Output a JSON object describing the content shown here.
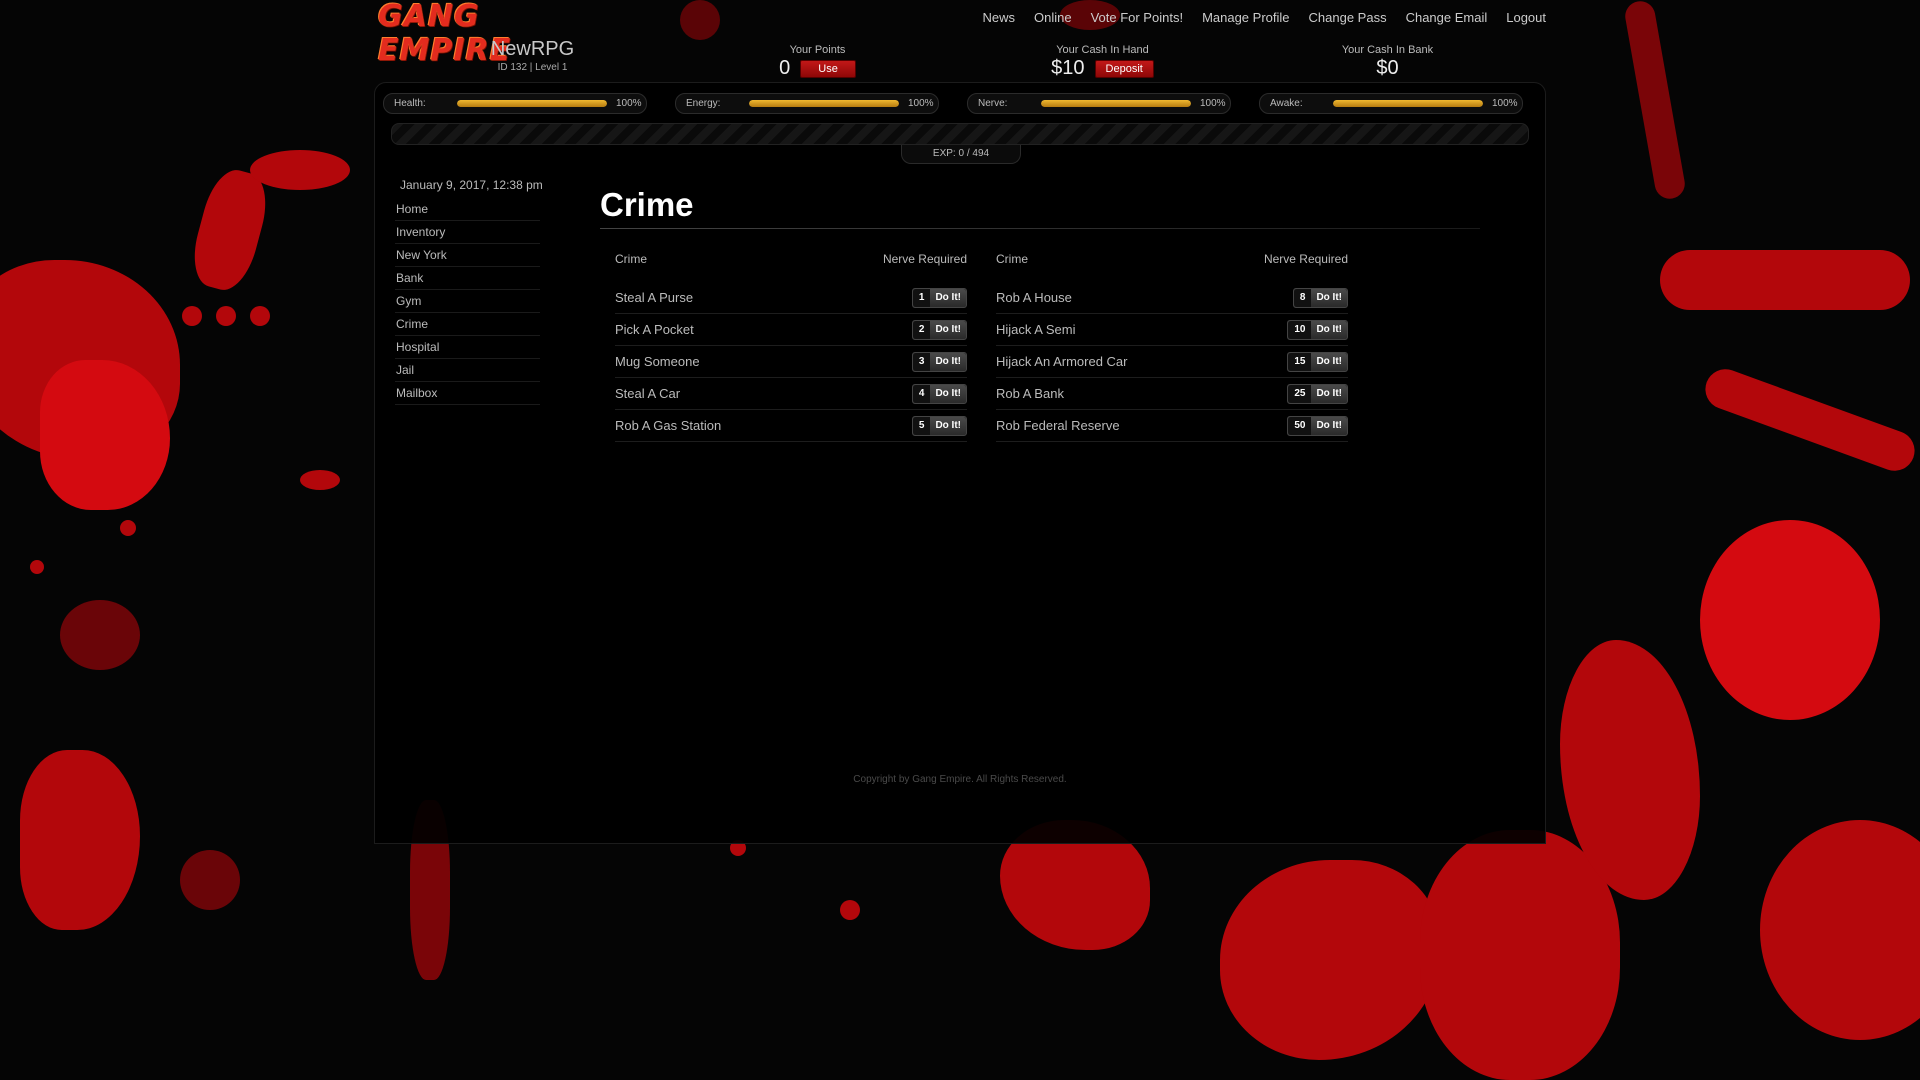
{
  "header": {
    "logo_text": "GANG EMPIRE",
    "nav": [
      "News",
      "Online",
      "Vote For Points!",
      "Manage Profile",
      "Change Pass",
      "Change Email",
      "Logout"
    ],
    "username": "NewRPG",
    "user_meta": "ID 132 | Level 1",
    "points": {
      "label": "Your Points",
      "value": "0",
      "button": "Use"
    },
    "cash_hand": {
      "label": "Your Cash In Hand",
      "value": "$10",
      "button": "Deposit"
    },
    "cash_bank": {
      "label": "Your Cash In Bank",
      "value": "$0"
    }
  },
  "bars": [
    {
      "label": "Health:",
      "pct": "100%",
      "fill": 1.0
    },
    {
      "label": "Energy:",
      "pct": "100%",
      "fill": 1.0
    },
    {
      "label": "Nerve:",
      "pct": "100%",
      "fill": 1.0
    },
    {
      "label": "Awake:",
      "pct": "100%",
      "fill": 1.0
    }
  ],
  "exp": "EXP: 0 / 494",
  "sidebar": {
    "date": "January 9, 2017, 12:38 pm",
    "items": [
      "Home",
      "Inventory",
      "New York",
      "Bank",
      "Gym",
      "Crime",
      "Hospital",
      "Jail",
      "Mailbox"
    ]
  },
  "main": {
    "title": "Crime",
    "col_crime": "Crime",
    "col_nerve": "Nerve Required",
    "do_label": "Do It!",
    "left_crimes": [
      {
        "name": "Steal A Purse",
        "nerve": "1"
      },
      {
        "name": "Pick A Pocket",
        "nerve": "2"
      },
      {
        "name": "Mug Someone",
        "nerve": "3"
      },
      {
        "name": "Steal A Car",
        "nerve": "4"
      },
      {
        "name": "Rob A Gas Station",
        "nerve": "5"
      }
    ],
    "right_crimes": [
      {
        "name": "Rob A House",
        "nerve": "8"
      },
      {
        "name": "Hijack A Semi",
        "nerve": "10"
      },
      {
        "name": "Hijack An Armored Car",
        "nerve": "15"
      },
      {
        "name": "Rob A Bank",
        "nerve": "25"
      },
      {
        "name": "Rob Federal Reserve",
        "nerve": "50"
      }
    ]
  },
  "footer": {
    "copyright": "Copyright by Gang Empire. All Rights Reserved."
  },
  "colors": {
    "accent": "#b3070b",
    "bar_fill": "#e0a020",
    "button_red": "#a80f0f"
  }
}
